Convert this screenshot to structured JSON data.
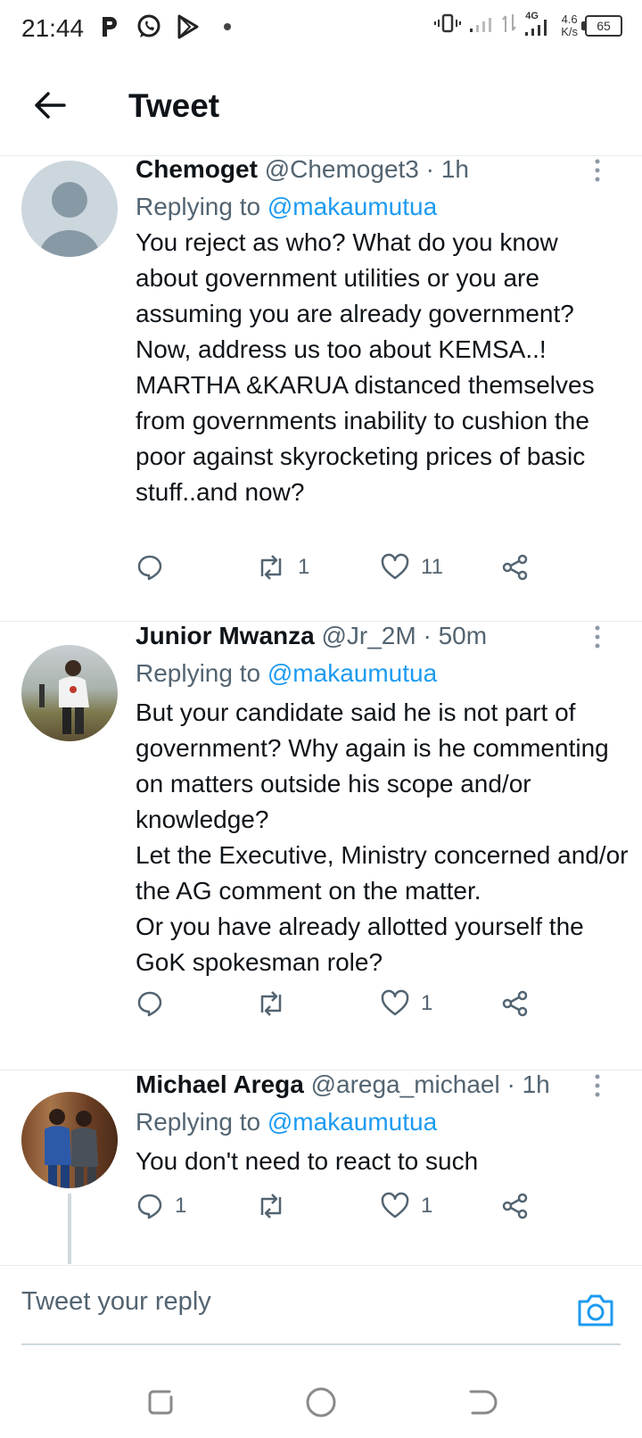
{
  "status_bar": {
    "time": "21:44",
    "network_type": "4G",
    "speed_value": "4.6",
    "speed_unit": "K/s",
    "battery": "65",
    "left_icons": [
      "p-icon",
      "whatsapp-icon",
      "play-store-icon",
      "dot-icon"
    ]
  },
  "header": {
    "title": "Tweet"
  },
  "tweets": [
    {
      "name": "Chemoget",
      "handle": "@Chemoget3",
      "time": "· 1h",
      "replying_prefix": "Replying to ",
      "replying_to": "@makaumutua",
      "text": "You reject as who? What do you know about government utilities or you are assuming you are already government? Now, address us too about KEMSA..! MARTHA &KARUA distanced themselves from governments inability to cushion the poor against skyrocketing prices of basic stuff..and now?",
      "replies": "",
      "retweets": "1",
      "likes": "11"
    },
    {
      "name": "Junior Mwanza",
      "handle": "@Jr_2M",
      "time": "· 50m",
      "replying_prefix": "Replying to ",
      "replying_to": "@makaumutua",
      "text": "But your candidate said he is not part of government? Why again is he commenting on matters outside his scope and/or knowledge?\nLet the Executive, Ministry concerned and/or the AG comment on the matter.\nOr you have already allotted yourself the GoK spokesman role?",
      "replies": "",
      "retweets": "",
      "likes": "1"
    },
    {
      "name": "Michael Arega",
      "handle": "@arega_michael",
      "time": "· 1h",
      "replying_prefix": "Replying to ",
      "replying_to": "@makaumutua",
      "text": "You don't need to react to such",
      "replies": "1",
      "retweets": "",
      "likes": "1"
    }
  ],
  "reply_bar": {
    "placeholder": "Tweet your reply"
  },
  "colors": {
    "link_blue": "#1d9bf0",
    "secondary_text": "#536471",
    "divider": "#e6ecf0"
  }
}
